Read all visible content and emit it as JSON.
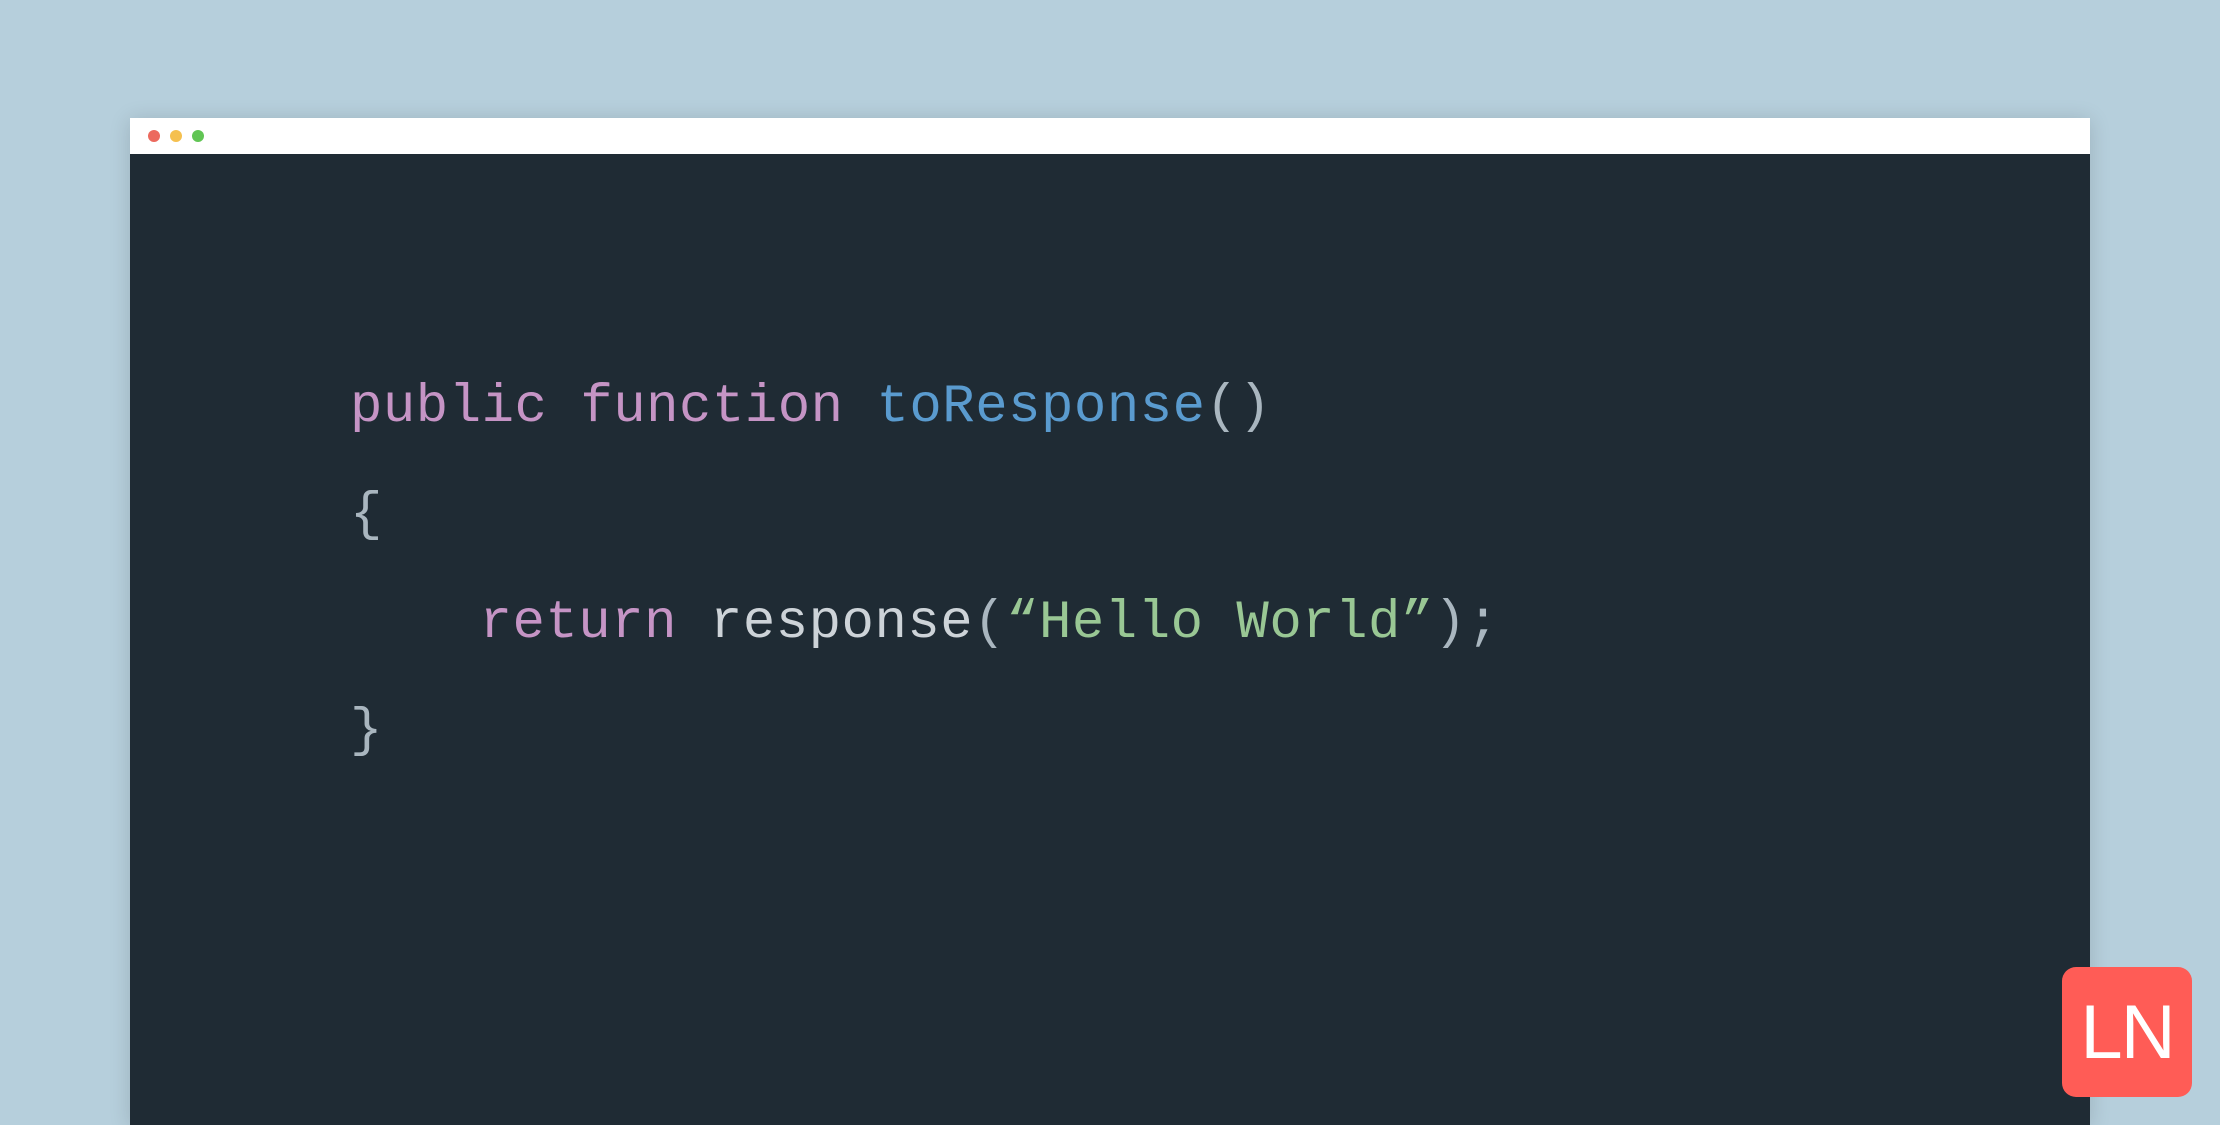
{
  "code": {
    "keyword_public": "public",
    "keyword_function": "function",
    "function_name": "toResponse",
    "parens_open": "(",
    "parens_close": ")",
    "brace_open": "{",
    "keyword_return": "return",
    "call_name": "response",
    "call_paren_open": "(",
    "string_value": "“Hello World”",
    "call_paren_close": ")",
    "semicolon": ";",
    "brace_close": "}"
  },
  "logo": {
    "text": "LN"
  },
  "colors": {
    "background": "#b6cfdc",
    "editor_bg": "#1f2b34",
    "keyword": "#c594c5",
    "function": "#5a9bcf",
    "punctuation": "#a9b6bf",
    "plain": "#cdd3d8",
    "string": "#99c794",
    "badge": "#ff5c56"
  }
}
